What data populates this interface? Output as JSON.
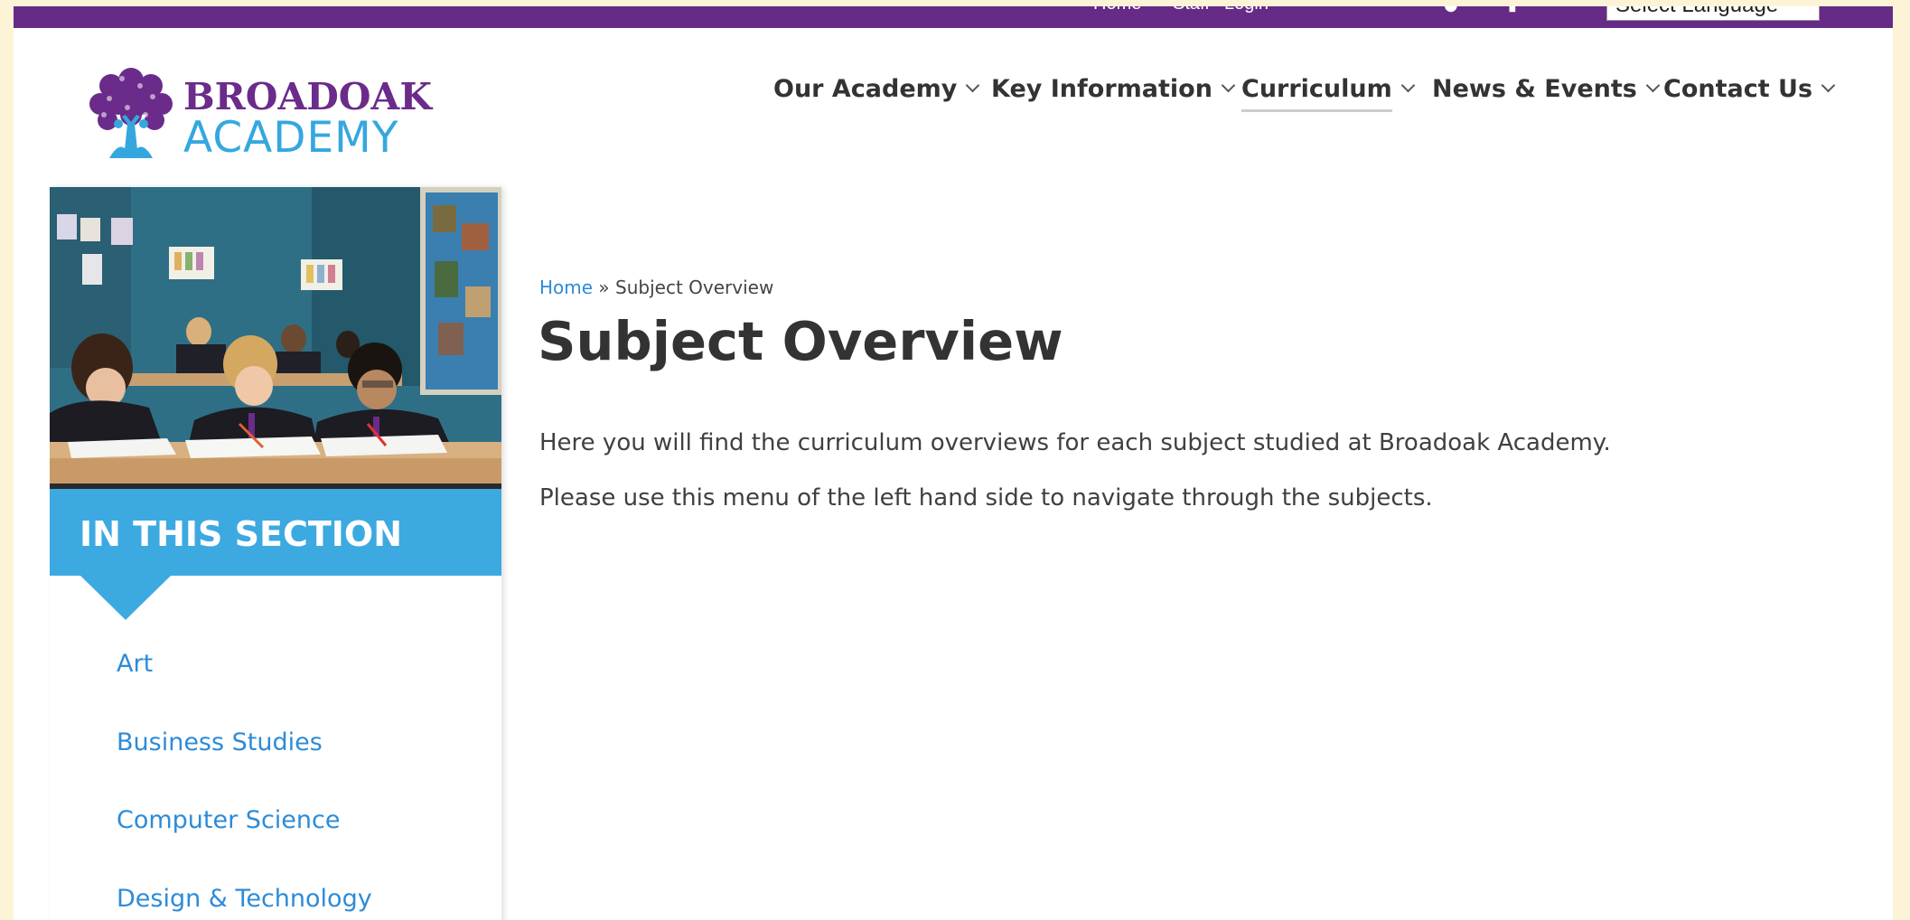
{
  "topbar": {
    "links": [
      "Home",
      "Staff",
      "Login"
    ],
    "language_select": "Select Language"
  },
  "logo": {
    "line1": "BROADOAK",
    "line2": "ACADEMY"
  },
  "nav": [
    {
      "label": "Our Academy",
      "active": false
    },
    {
      "label": "Key Information",
      "active": false
    },
    {
      "label": "Curriculum",
      "active": true
    },
    {
      "label": "News & Events",
      "active": false
    },
    {
      "label": "Contact Us",
      "active": false
    }
  ],
  "sidebar": {
    "section_title": "IN THIS SECTION",
    "items": [
      "Art",
      "Business Studies",
      "Computer Science",
      "Design & Technology"
    ]
  },
  "breadcrumb": {
    "home": "Home",
    "separator": "»",
    "current": "Subject Overview"
  },
  "page": {
    "title": "Subject Overview",
    "paragraphs": [
      "Here you will find the curriculum overviews for each subject studied at Broadoak Academy.",
      "Please use this menu of the left hand side to navigate through the subjects."
    ]
  },
  "colors": {
    "brand_purple": "#652b86",
    "brand_blue": "#3da9e1",
    "link_blue": "#2d8bd8",
    "outer_background": "#fdf3d6"
  }
}
